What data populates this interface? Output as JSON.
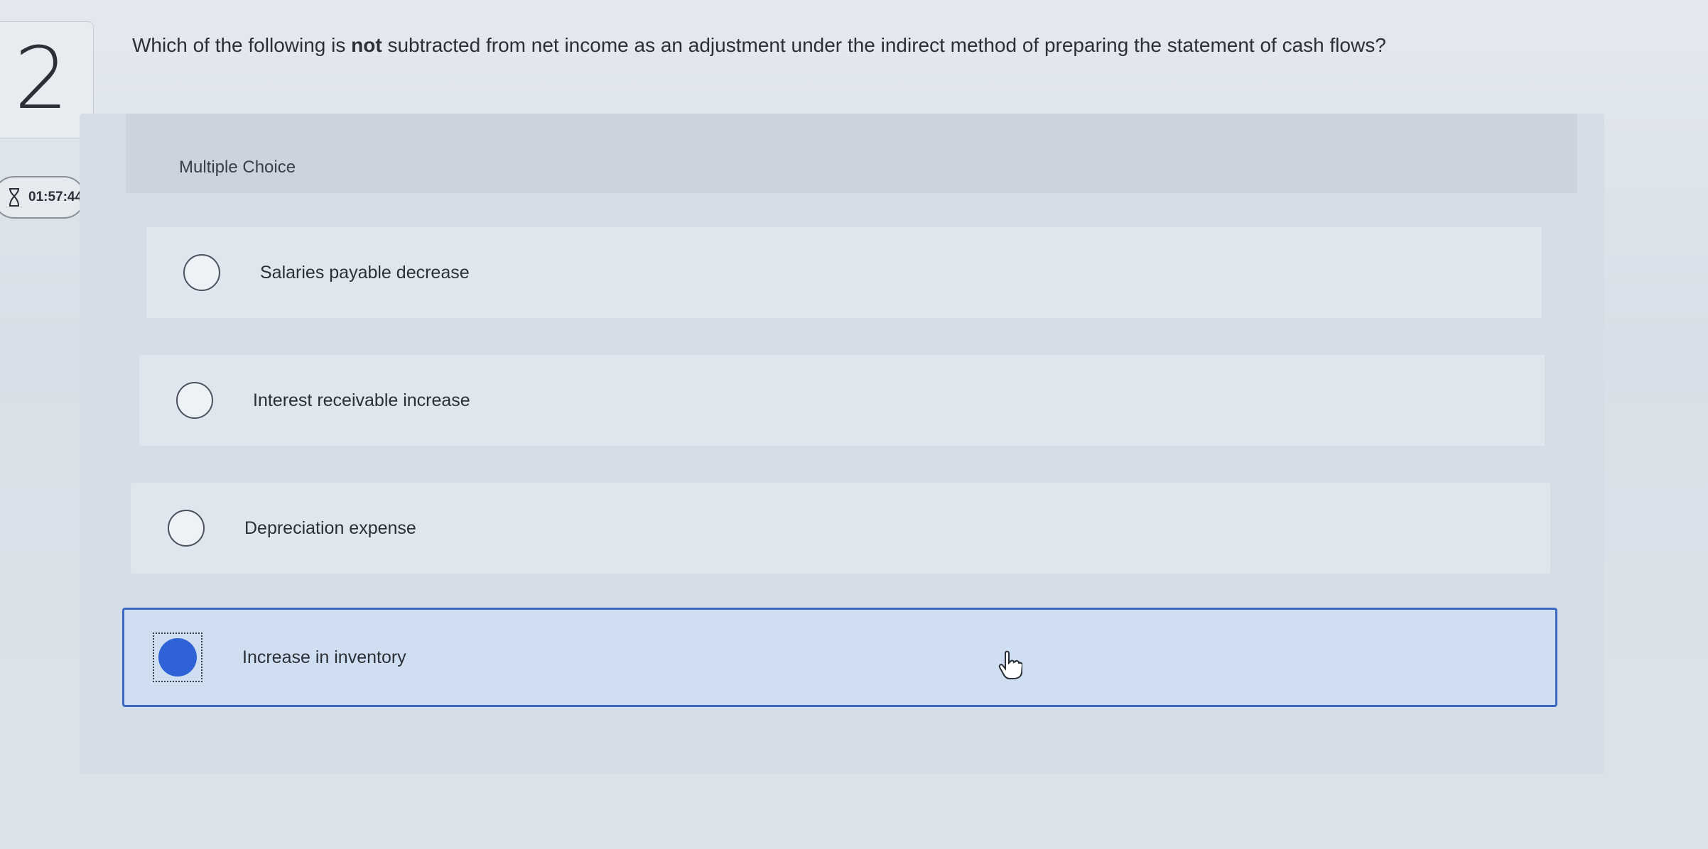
{
  "question_number": "2",
  "timer": "01:57:44",
  "question": {
    "before": "Which of the following is ",
    "emphasis": "not",
    "after": " subtracted from net income as an adjustment under the indirect method of preparing the statement of cash flows?"
  },
  "multiple_choice_label": "Multiple Choice",
  "options": [
    {
      "label": "Salaries payable decrease",
      "selected": false
    },
    {
      "label": "Interest receivable increase",
      "selected": false
    },
    {
      "label": "Depreciation expense",
      "selected": false
    },
    {
      "label": "Increase in inventory",
      "selected": true
    }
  ],
  "colors": {
    "selected_border": "#3a66c4",
    "selected_fill": "#2f62d6",
    "selected_bg": "#cfdff1"
  }
}
